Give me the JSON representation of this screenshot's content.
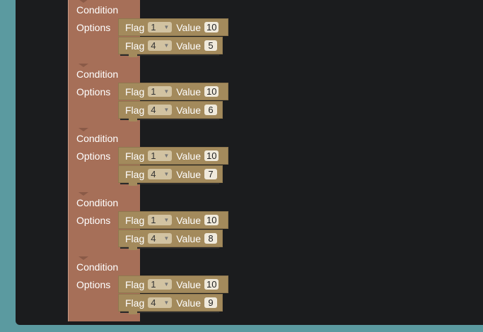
{
  "blocks": [
    {
      "condition": "Condition",
      "options": "Options",
      "flags": [
        {
          "flag": "Flag",
          "flag_value": "1",
          "value_label": "Value",
          "value": "10"
        },
        {
          "flag": "Flag",
          "flag_value": "4",
          "value_label": "Value",
          "value": "5"
        }
      ]
    },
    {
      "condition": "Condition",
      "options": "Options",
      "flags": [
        {
          "flag": "Flag",
          "flag_value": "1",
          "value_label": "Value",
          "value": "10"
        },
        {
          "flag": "Flag",
          "flag_value": "4",
          "value_label": "Value",
          "value": "6"
        }
      ]
    },
    {
      "condition": "Condition",
      "options": "Options",
      "flags": [
        {
          "flag": "Flag",
          "flag_value": "1",
          "value_label": "Value",
          "value": "10"
        },
        {
          "flag": "Flag",
          "flag_value": "4",
          "value_label": "Value",
          "value": "7"
        }
      ]
    },
    {
      "condition": "Condition",
      "options": "Options",
      "flags": [
        {
          "flag": "Flag",
          "flag_value": "1",
          "value_label": "Value",
          "value": "10"
        },
        {
          "flag": "Flag",
          "flag_value": "4",
          "value_label": "Value",
          "value": "8"
        }
      ]
    },
    {
      "condition": "Condition",
      "options": "Options",
      "flags": [
        {
          "flag": "Flag",
          "flag_value": "1",
          "value_label": "Value",
          "value": "10"
        },
        {
          "flag": "Flag",
          "flag_value": "4",
          "value_label": "Value",
          "value": "9"
        }
      ]
    }
  ],
  "colors": {
    "condition_block": "#a66f58",
    "flag_block": "#a38a5c",
    "workspace": "#1b1c1e",
    "frame": "#5b9aa0"
  }
}
